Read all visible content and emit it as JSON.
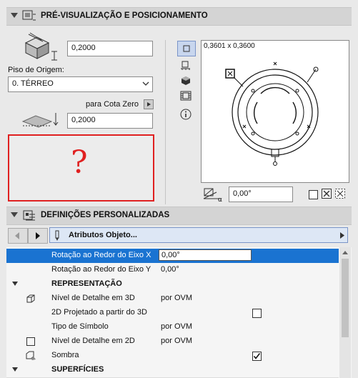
{
  "preview_section": {
    "title": "PRÉ-VISUALIZAÇÃO E POSICIONAMENTO",
    "height_value": "0,2000",
    "origin_floor_label": "Piso de Origem:",
    "origin_floor_value": "0. TÉRREO",
    "zero_label": "para Cota Zero",
    "elevation_value": "0,2000",
    "preview_size": "0,3601 x 0,3600",
    "angle_value": "0,00°",
    "missing_glyph": "?"
  },
  "custom_section": {
    "title": "DEFINIÇÕES PERSONALIZADAS",
    "dropdown_label": "Atributos Objeto..."
  },
  "properties": [
    {
      "label": "Rotação ao Redor do Eixo X",
      "value": "0,00°"
    },
    {
      "label": "Rotação ao Redor do Eixo Y",
      "value": "0,00°"
    },
    {
      "label": "REPRESENTAÇÃO",
      "value": ""
    },
    {
      "label": "Nível de Detalhe em 3D",
      "value": "por OVM"
    },
    {
      "label": "2D Projetado a partir do 3D",
      "value": ""
    },
    {
      "label": "Tipo de Símbolo",
      "value": "por OVM"
    },
    {
      "label": "Nível de Detalhe em 2D",
      "value": "por OVM"
    },
    {
      "label": "Sombra",
      "value": ""
    },
    {
      "label": "SUPERFÍCIES",
      "value": ""
    }
  ],
  "colors": {
    "selection": "#1a73d1",
    "warning": "#e02020"
  }
}
